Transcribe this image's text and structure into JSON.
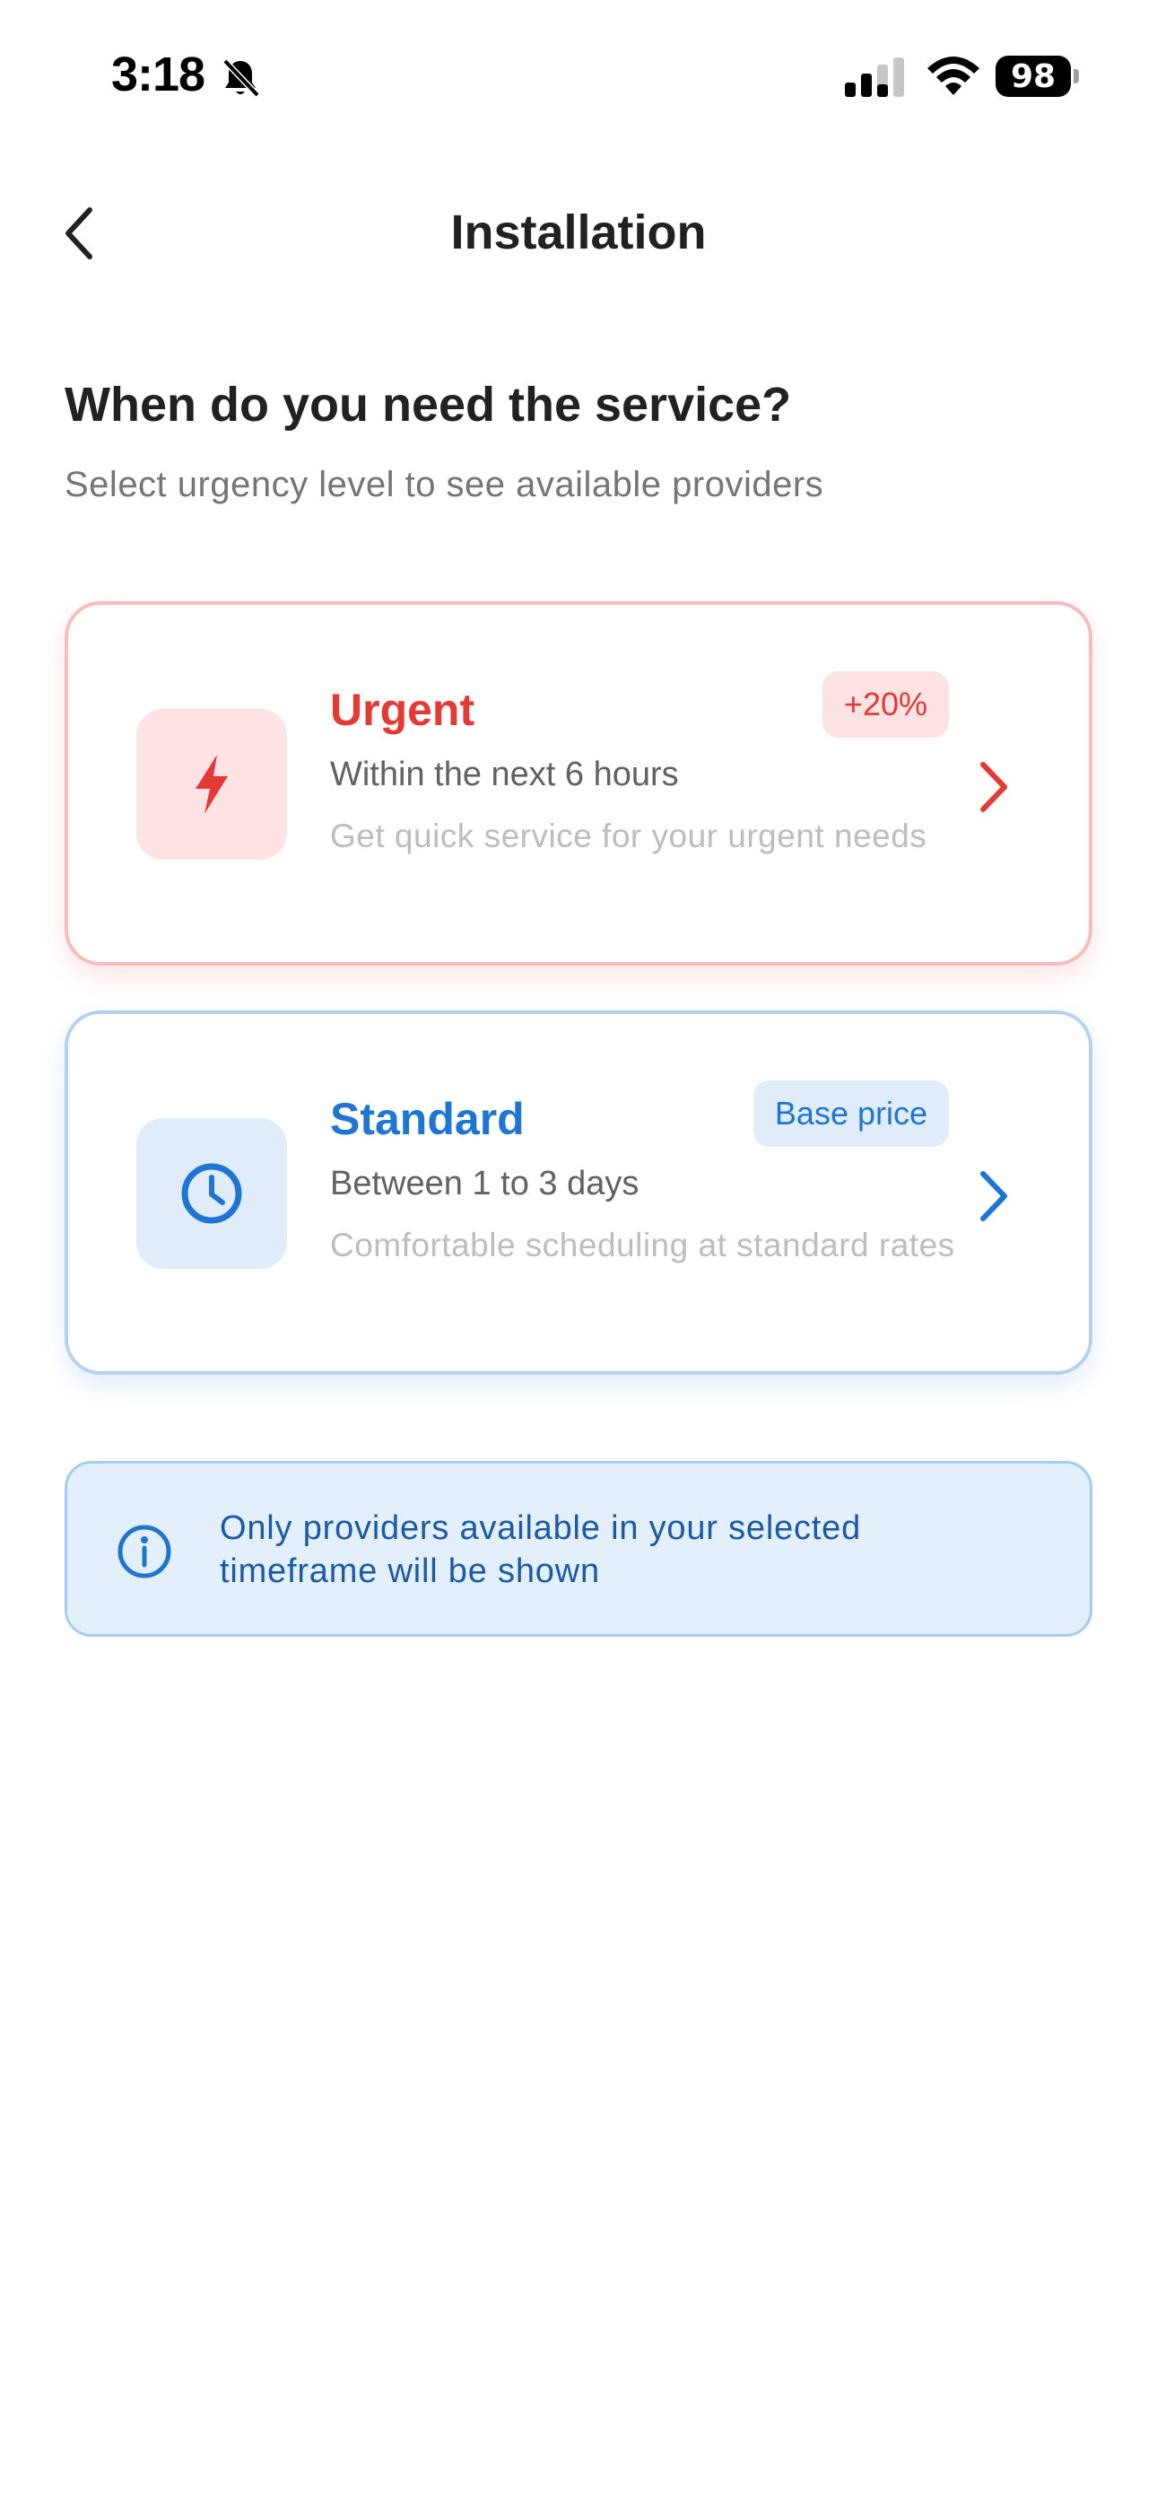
{
  "status_bar": {
    "time": "3:18",
    "battery": "98",
    "icons": [
      "bell-off-icon",
      "cellular-signal-icon",
      "wifi-icon",
      "battery-icon"
    ]
  },
  "header": {
    "title": "Installation",
    "back_icon": "chevron-left-icon"
  },
  "main": {
    "heading": "When do you need the service?",
    "subheading": "Select urgency level to see available providers",
    "options": [
      {
        "id": "urgent",
        "icon": "lightning-icon",
        "title": "Urgent",
        "badge": "+20%",
        "time": "Within the next 6 hours",
        "description": "Get quick service for your urgent needs",
        "color": "#e53935"
      },
      {
        "id": "standard",
        "icon": "clock-icon",
        "title": "Standard",
        "badge": "Base price",
        "time": "Between 1 to 3 days",
        "description": "Comfortable scheduling at standard rates",
        "color": "#1e76d2"
      }
    ],
    "info": {
      "icon": "info-icon",
      "text": "Only providers available in your selected timeframe will be shown"
    }
  }
}
